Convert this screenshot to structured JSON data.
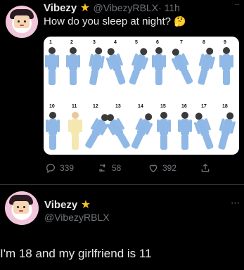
{
  "tweet1": {
    "name": "Vibezy",
    "handle": "@VibezyRBLX",
    "time": "· 11h",
    "text": "How do you sleep at night?",
    "emoji": "🤔",
    "image": {
      "numbers": [
        "1",
        "2",
        "3",
        "4",
        "5",
        "6",
        "7",
        "8",
        "9",
        "10",
        "11",
        "12",
        "13",
        "14",
        "15",
        "16",
        "17",
        "18"
      ]
    },
    "actions": {
      "replies": "339",
      "retweets": "58",
      "likes": "392"
    }
  },
  "tweet2": {
    "name": "Vibezy",
    "handle": "@VibezyRBLX",
    "text": "I'm 18 and my girlfriend is 11"
  },
  "colors": {
    "background": "#000000",
    "text": "#e7e9ea",
    "muted": "#71767b",
    "verified_star": "#f7c325",
    "pajama_blue": "#8fb8e6"
  },
  "icons": [
    "star-icon",
    "thinking-face-emoji",
    "more-icon",
    "reply-icon",
    "retweet-icon",
    "like-icon",
    "share-icon"
  ]
}
